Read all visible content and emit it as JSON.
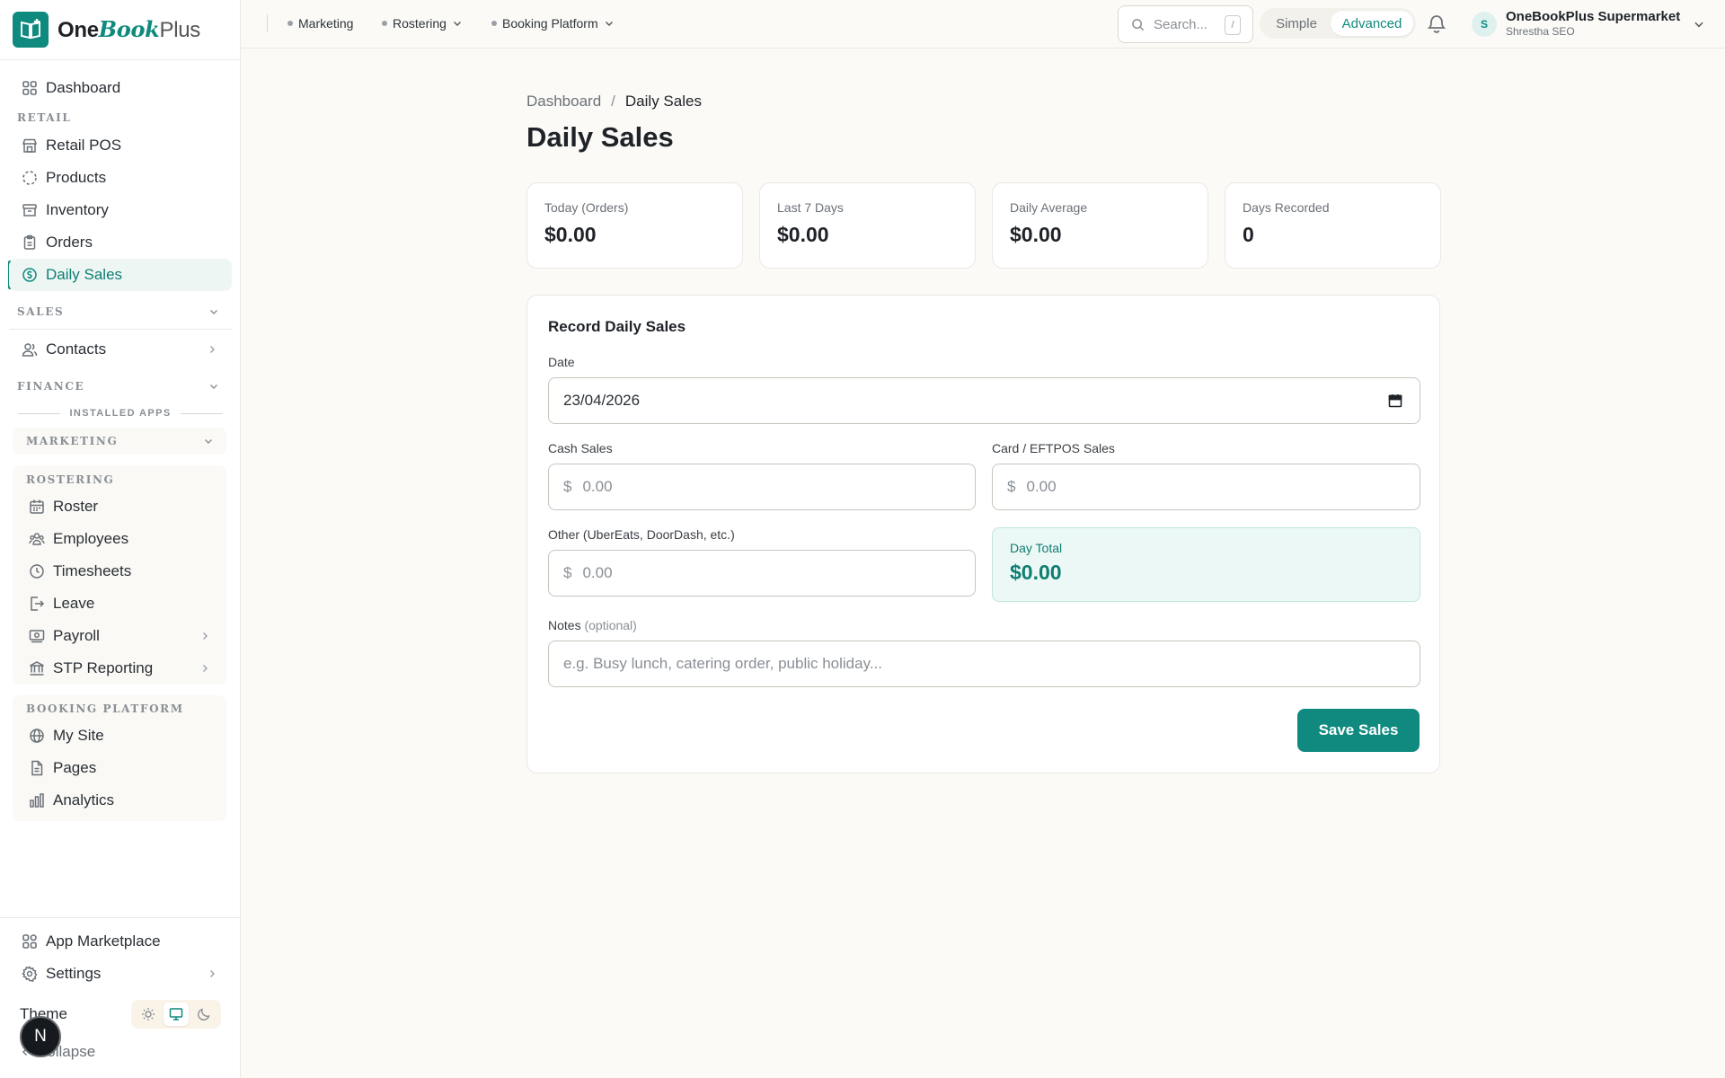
{
  "brand": {
    "one": "One",
    "book": "Book",
    "plus": "Plus"
  },
  "sidebar": {
    "dashboard": "Dashboard",
    "retail_label": "RETAIL",
    "retail_items": [
      "Retail POS",
      "Products",
      "Inventory",
      "Orders",
      "Daily Sales"
    ],
    "sales_label": "SALES",
    "contacts": "Contacts",
    "finance_label": "FINANCE",
    "installed_apps": "INSTALLED APPS",
    "marketing_label": "MARKETING",
    "rostering_label": "ROSTERING",
    "rostering_items": [
      "Roster",
      "Employees",
      "Timesheets",
      "Leave",
      "Payroll",
      "STP Reporting"
    ],
    "booking_label": "BOOKING PLATFORM",
    "booking_items": [
      "My Site",
      "Pages",
      "Analytics"
    ],
    "app_marketplace": "App Marketplace",
    "settings": "Settings",
    "theme": "Theme",
    "collapse": "Collapse",
    "badge": "N"
  },
  "topbar": {
    "nav": [
      "Marketing",
      "Rostering",
      "Booking Platform"
    ],
    "search_placeholder": "Search...",
    "search_shortcut": "/",
    "mode_simple": "Simple",
    "mode_advanced": "Advanced",
    "user_initial": "S",
    "user_name": "OneBookPlus Supermarket",
    "user_role": "Shrestha SEO"
  },
  "breadcrumb": {
    "parent": "Dashboard",
    "separator": "/",
    "current": "Daily Sales"
  },
  "page_title": "Daily Sales",
  "stats": [
    {
      "label": "Today (Orders)",
      "value": "$0.00"
    },
    {
      "label": "Last 7 Days",
      "value": "$0.00"
    },
    {
      "label": "Daily Average",
      "value": "$0.00"
    },
    {
      "label": "Days Recorded",
      "value": "0"
    }
  ],
  "form": {
    "title": "Record Daily Sales",
    "date_label": "Date",
    "date_value": "23/04/2026",
    "cash_label": "Cash Sales",
    "card_label": "Card / EFTPOS Sales",
    "other_label": "Other (UberEats, DoorDash, etc.)",
    "currency": "$",
    "amount_placeholder": "0.00",
    "total_label": "Day Total",
    "total_value": "$0.00",
    "notes_label": "Notes",
    "notes_optional": "(optional)",
    "notes_placeholder": "e.g. Busy lunch, catering order, public holiday...",
    "save_label": "Save Sales"
  },
  "colors": {
    "accent": "#0f8a7e",
    "background": "#fbfaf7",
    "total_bg": "#ecf8f6"
  }
}
